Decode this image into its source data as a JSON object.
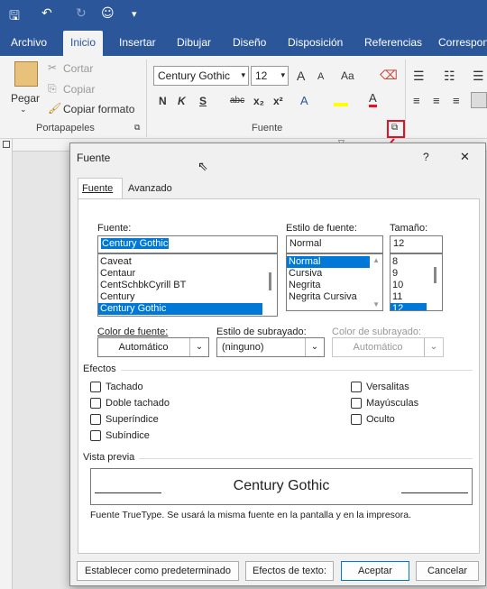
{
  "tabs": [
    {
      "label": "Archivo",
      "active": false
    },
    {
      "label": "Inicio",
      "active": true
    },
    {
      "label": "Insertar",
      "active": false
    },
    {
      "label": "Dibujar",
      "active": false
    },
    {
      "label": "Diseño",
      "active": false
    },
    {
      "label": "Disposición",
      "active": false
    },
    {
      "label": "Referencias",
      "active": false
    },
    {
      "label": "Correspon",
      "active": false
    }
  ],
  "clipboard": {
    "paste": "Pegar",
    "cut": "Cortar",
    "copy": "Copiar",
    "format_painter": "Copiar formato",
    "group": "Portapapeles"
  },
  "font_group": {
    "font_name": "Century Gothic",
    "font_size": "12",
    "group": "Fuente",
    "bold": "N",
    "italic": "K",
    "underline": "S",
    "strikethrough": "abc",
    "subscript": "x₂",
    "superscript": "x²",
    "grow": "A",
    "shrink": "A",
    "case": "Aa"
  },
  "dialog": {
    "title": "Fuente",
    "help": "?",
    "close": "✕",
    "tabs": [
      "Fuente",
      "Avanzado"
    ],
    "font_label": "Fuente:",
    "font_value": "Century Gothic",
    "font_list": [
      "Caveat",
      "Centaur",
      "CentSchbkCyrill BT",
      "Century",
      "Century Gothic"
    ],
    "font_selected": "Century Gothic",
    "style_label": "Estilo de fuente:",
    "style_value": "Normal",
    "style_list": [
      "Normal",
      "Cursiva",
      "Negrita",
      "Negrita Cursiva"
    ],
    "style_selected": "Normal",
    "size_label": "Tamaño:",
    "size_value": "12",
    "size_list": [
      "8",
      "9",
      "10",
      "11",
      "12"
    ],
    "size_selected": "12",
    "font_color_label": "Color de fuente:",
    "font_color_value": "Automático",
    "underline_style_label": "Estilo de subrayado:",
    "underline_style_value": "(ninguno)",
    "underline_color_label": "Color de subrayado:",
    "underline_color_value": "Automático",
    "effects_label": "Efectos",
    "effects_left": [
      "Tachado",
      "Doble tachado",
      "Superíndice",
      "Subíndice"
    ],
    "effects_right": [
      "Versalitas",
      "Mayúsculas",
      "Oculto"
    ],
    "preview_label": "Vista previa",
    "preview_text": "Century Gothic",
    "preview_note": "Fuente TrueType. Se usará la misma fuente en la pantalla y en la impresora.",
    "btn_default": "Establecer como predeterminado",
    "btn_effects": "Efectos de texto:",
    "btn_ok": "Aceptar",
    "btn_cancel": "Cancelar"
  },
  "colors": {
    "brand": "#2b579a",
    "highlight": "#0078d7",
    "annotation": "#e81123"
  }
}
